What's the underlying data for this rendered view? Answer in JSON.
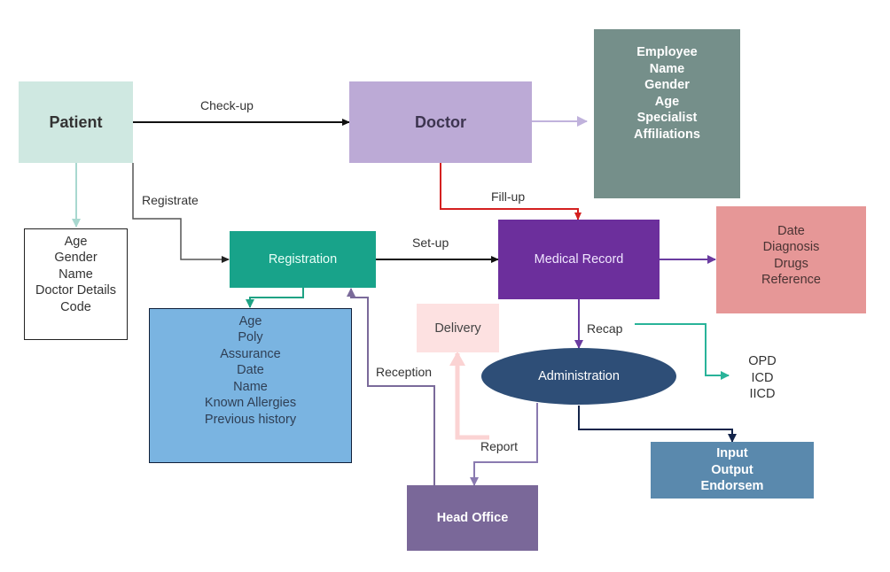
{
  "nodes": {
    "patient": {
      "title": "Patient",
      "fill": "#cfe8e1",
      "text_color": "#333333"
    },
    "doctor": {
      "title": "Doctor",
      "fill": "#bcaad6",
      "text_color": "#3d3550"
    },
    "employee_info": {
      "lines": [
        "Employee",
        "Name",
        "Gender",
        "Age",
        "Specialist",
        "Affiliations"
      ],
      "fill": "#758f8a",
      "text_color": "#ffffff"
    },
    "patient_info": {
      "lines": [
        "Age",
        "Gender",
        "Name",
        "Doctor Details",
        "Code"
      ],
      "fill": "#ffffff",
      "text_color": "#333333"
    },
    "registration": {
      "title": "Registration",
      "fill": "#18a38a",
      "text_color": "#eafff8"
    },
    "registration_info": {
      "lines": [
        "Age",
        "Poly",
        "Assurance",
        "Date",
        "Name",
        "Known Allergies",
        "Previous history"
      ],
      "fill": "#7ab4e1",
      "text_color": "#2f3f55"
    },
    "medical_record": {
      "title": "Medical Record",
      "fill": "#6c2f9c",
      "text_color": "#f0e6ff"
    },
    "record_info": {
      "lines": [
        "Date",
        "Diagnosis",
        "Drugs",
        "Reference"
      ],
      "fill": "#e69797",
      "text_color": "#4a3333"
    },
    "delivery": {
      "title": "Delivery",
      "fill": "#fde1e1",
      "text_color": "#444444"
    },
    "administration": {
      "title": "Administration",
      "fill": "#2e4e77",
      "text_color": "#ffffff"
    },
    "recap_codes": {
      "lines": [
        "OPD",
        "ICD",
        "IICD"
      ],
      "text_color": "#333333"
    },
    "head_office": {
      "title": "Head Office",
      "fill": "#7a6899",
      "text_color": "#ffffff"
    },
    "admin_output": {
      "lines": [
        "Input",
        "Output",
        "Endorsem"
      ],
      "fill": "#5a89ad",
      "text_color": "#ffffff"
    }
  },
  "edges": {
    "checkup": {
      "label": "Check-up",
      "color": "#111111"
    },
    "registrate": {
      "label": "Registrate",
      "color": "#555555"
    },
    "fillup": {
      "label": "Fill-up",
      "color": "#d42020"
    },
    "setup": {
      "label": "Set-up",
      "color": "#111111"
    },
    "recap": {
      "label": "Recap",
      "color": "#6a3ca0"
    },
    "reception": {
      "label": "Reception",
      "color": "#7a6a9a"
    },
    "report": {
      "label": "Report",
      "color": "#8a7ab0"
    },
    "doctor_details": {
      "color": "#c0b2dc"
    },
    "patient_details": {
      "color": "#a8d8cf"
    },
    "registration_details": {
      "color": "#1fa284"
    },
    "record_details": {
      "color": "#6a3ca0"
    },
    "recap_codes": {
      "color": "#29b399"
    },
    "admin_output": {
      "color": "#13244a"
    },
    "delivery_feed": {
      "color": "#fbd3d3"
    }
  }
}
